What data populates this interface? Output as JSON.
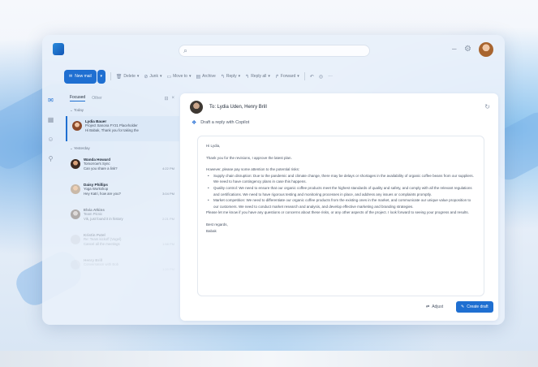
{
  "window": {
    "search_placeholder": ""
  },
  "toolbar": {
    "new_mail": "New mail",
    "delete": "Delete",
    "junk": "Junk",
    "move_to": "Move to",
    "archive": "Archive",
    "reply": "Reply",
    "reply_all": "Reply all",
    "forward": "Forward"
  },
  "list": {
    "tab_focused": "Focused",
    "tab_other": "Other",
    "group_today": "Today",
    "group_yesterday": "Yesterday",
    "messages": [
      {
        "from": "Lydia Bauer",
        "subject": "Project Sanona FY21 Placeholder",
        "preview": "Hi Babak, Thank you for taking the",
        "time": ""
      },
      {
        "from": "Wanda Howard",
        "subject": "Tomorrow's Sync",
        "preview": "Can you share a link?",
        "time": "4:22 PM"
      },
      {
        "from": "Daisy Phillips",
        "subject": "Yoga Workshop",
        "preview": "Hey Katri, how are you?",
        "time": "3:04 PM"
      },
      {
        "from": "Elvia Atkins",
        "subject": "Team Picnic",
        "preview": "Vik, just found it in history",
        "time": "2:21 PM"
      },
      {
        "from": "Kristin Patel",
        "subject": "Re: Team kickoff (Vogel)",
        "preview": "Cancel all the meetings",
        "time": "1:58 PM"
      },
      {
        "from": "Henry Brill",
        "subject": "Conversation with Bob",
        "preview": "",
        "time": "1:20 PM"
      }
    ]
  },
  "pane": {
    "to_line": "To: Lydia Uden, Henry Brill",
    "copilot_label": "Draft a reply with Copilot",
    "draft": {
      "greeting": "Hi Lydia,",
      "intro": "Thank you for the revisions, I approve the latest plan.",
      "lead": "However, please pay some attention to the potential risks:",
      "bullets": [
        "Supply chain disruption: Due to the pandemic and climate change, there may be delays or shortages in the availability of organic coffee beans from our suppliers. We need to have contingency plans in case this happens.",
        "Quality control: We need to ensure that our organic coffee products meet the highest standards of quality and safety, and comply with all the relevant regulations and certifications. We need to have rigorous testing and monitoring processes in place, and address any issues or complaints promptly.",
        "Market competition: We need to differentiate our organic coffee products from the existing ones in the market, and communicate our unique value proposition to our customers. We need to conduct market research and analysis, and develop effective marketing and branding strategies."
      ],
      "closing_1": "Please let me know if you have any questions or concerns about these risks, or any other aspects of the project. I look forward to seeing your progress and results.",
      "regards": "Best regards,",
      "signature": "Babak"
    },
    "adjust_label": "Adjust",
    "create_label": "Create draft"
  }
}
